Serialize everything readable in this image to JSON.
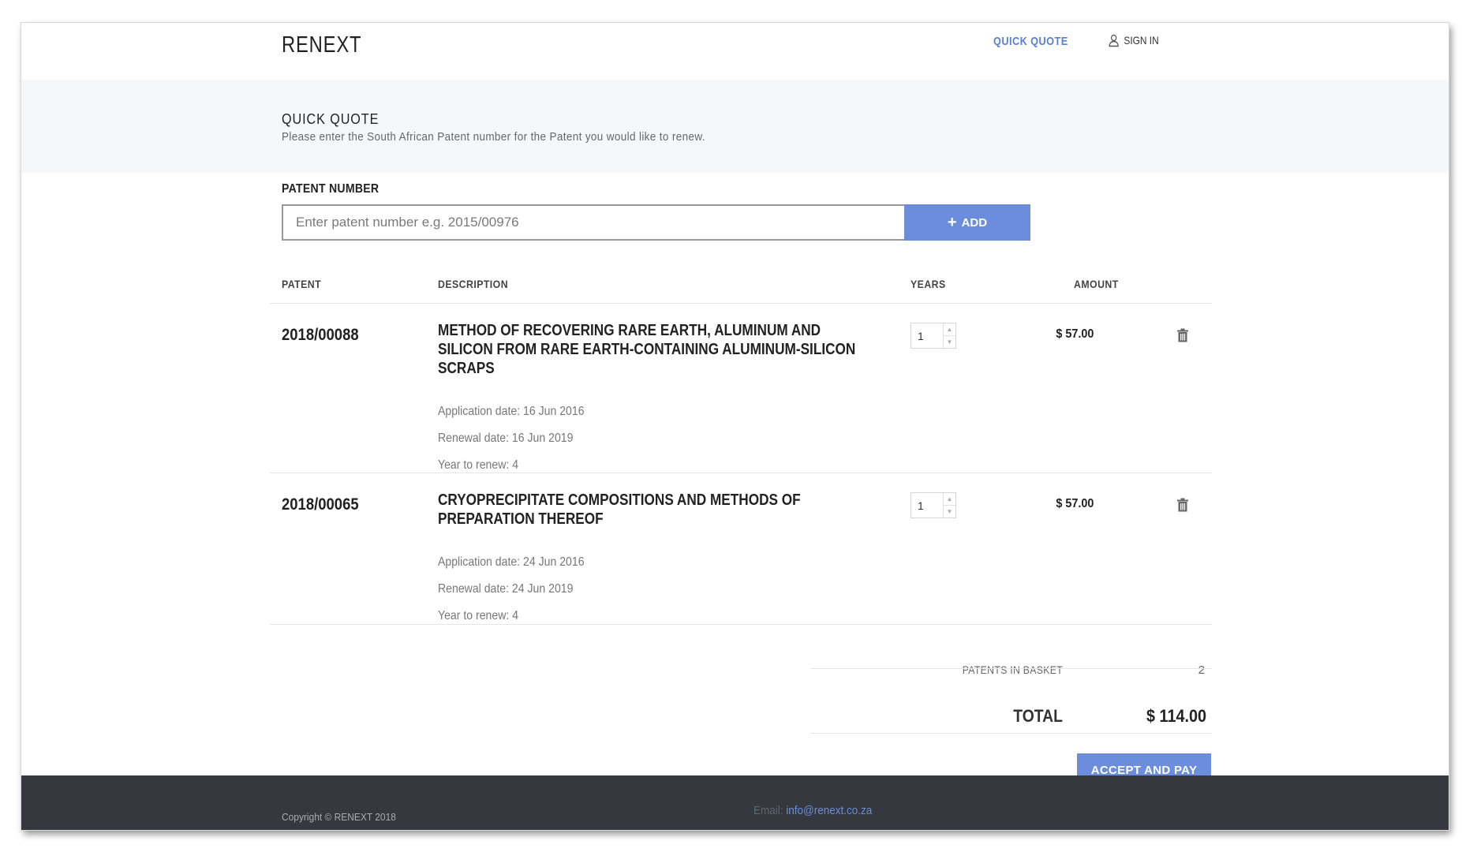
{
  "header": {
    "logo": "RENEXT",
    "nav_quick_quote": "QUICK QUOTE",
    "nav_sign_in": "SIGN IN"
  },
  "hero": {
    "title": "QUICK QUOTE",
    "subtitle": "Please enter the South African Patent number for the Patent you would like to renew."
  },
  "form": {
    "label": "PATENT NUMBER",
    "input_placeholder": "Enter patent number e.g. 2015/00976",
    "add_label": "ADD"
  },
  "table": {
    "headers": [
      "PATENT",
      "DESCRIPTION",
      "YEARS",
      "AMOUNT"
    ],
    "rows": [
      {
        "patent": "2018/00088",
        "description": "METHOD OF RECOVERING RARE EARTH, ALUMINUM AND SILICON FROM RARE EARTH-CONTAINING ALUMINUM-SILICON SCRAPS",
        "application_date": "Application date: 16 Jun 2016",
        "renewal_date": "Renewal date: 16 Jun 2019",
        "year_to_renew": "Year to renew: 4",
        "years": "1",
        "amount": "$ 57.00"
      },
      {
        "patent": "2018/00065",
        "description": "CRYOPRECIPITATE COMPOSITIONS AND METHODS OF PREPARATION THEREOF",
        "application_date": "Application date: 24 Jun 2016",
        "renewal_date": "Renewal date: 24 Jun 2019",
        "year_to_renew": "Year to renew: 4",
        "years": "1",
        "amount": "$ 57.00"
      }
    ]
  },
  "summary": {
    "basket_label": "PATENTS IN BASKET",
    "basket_count": "2",
    "total_label": "TOTAL",
    "total_value": "$ 114.00",
    "pay_label": "ACCEPT AND PAY"
  },
  "footer": {
    "copyright": "Copyright © RENEXT 2018",
    "email_label": "Email:",
    "email_address": "info@renext.co.za"
  },
  "colors": {
    "accent": "#6b8ddb",
    "hero_bg": "#f5f8f9",
    "footer_bg": "#35393f"
  }
}
